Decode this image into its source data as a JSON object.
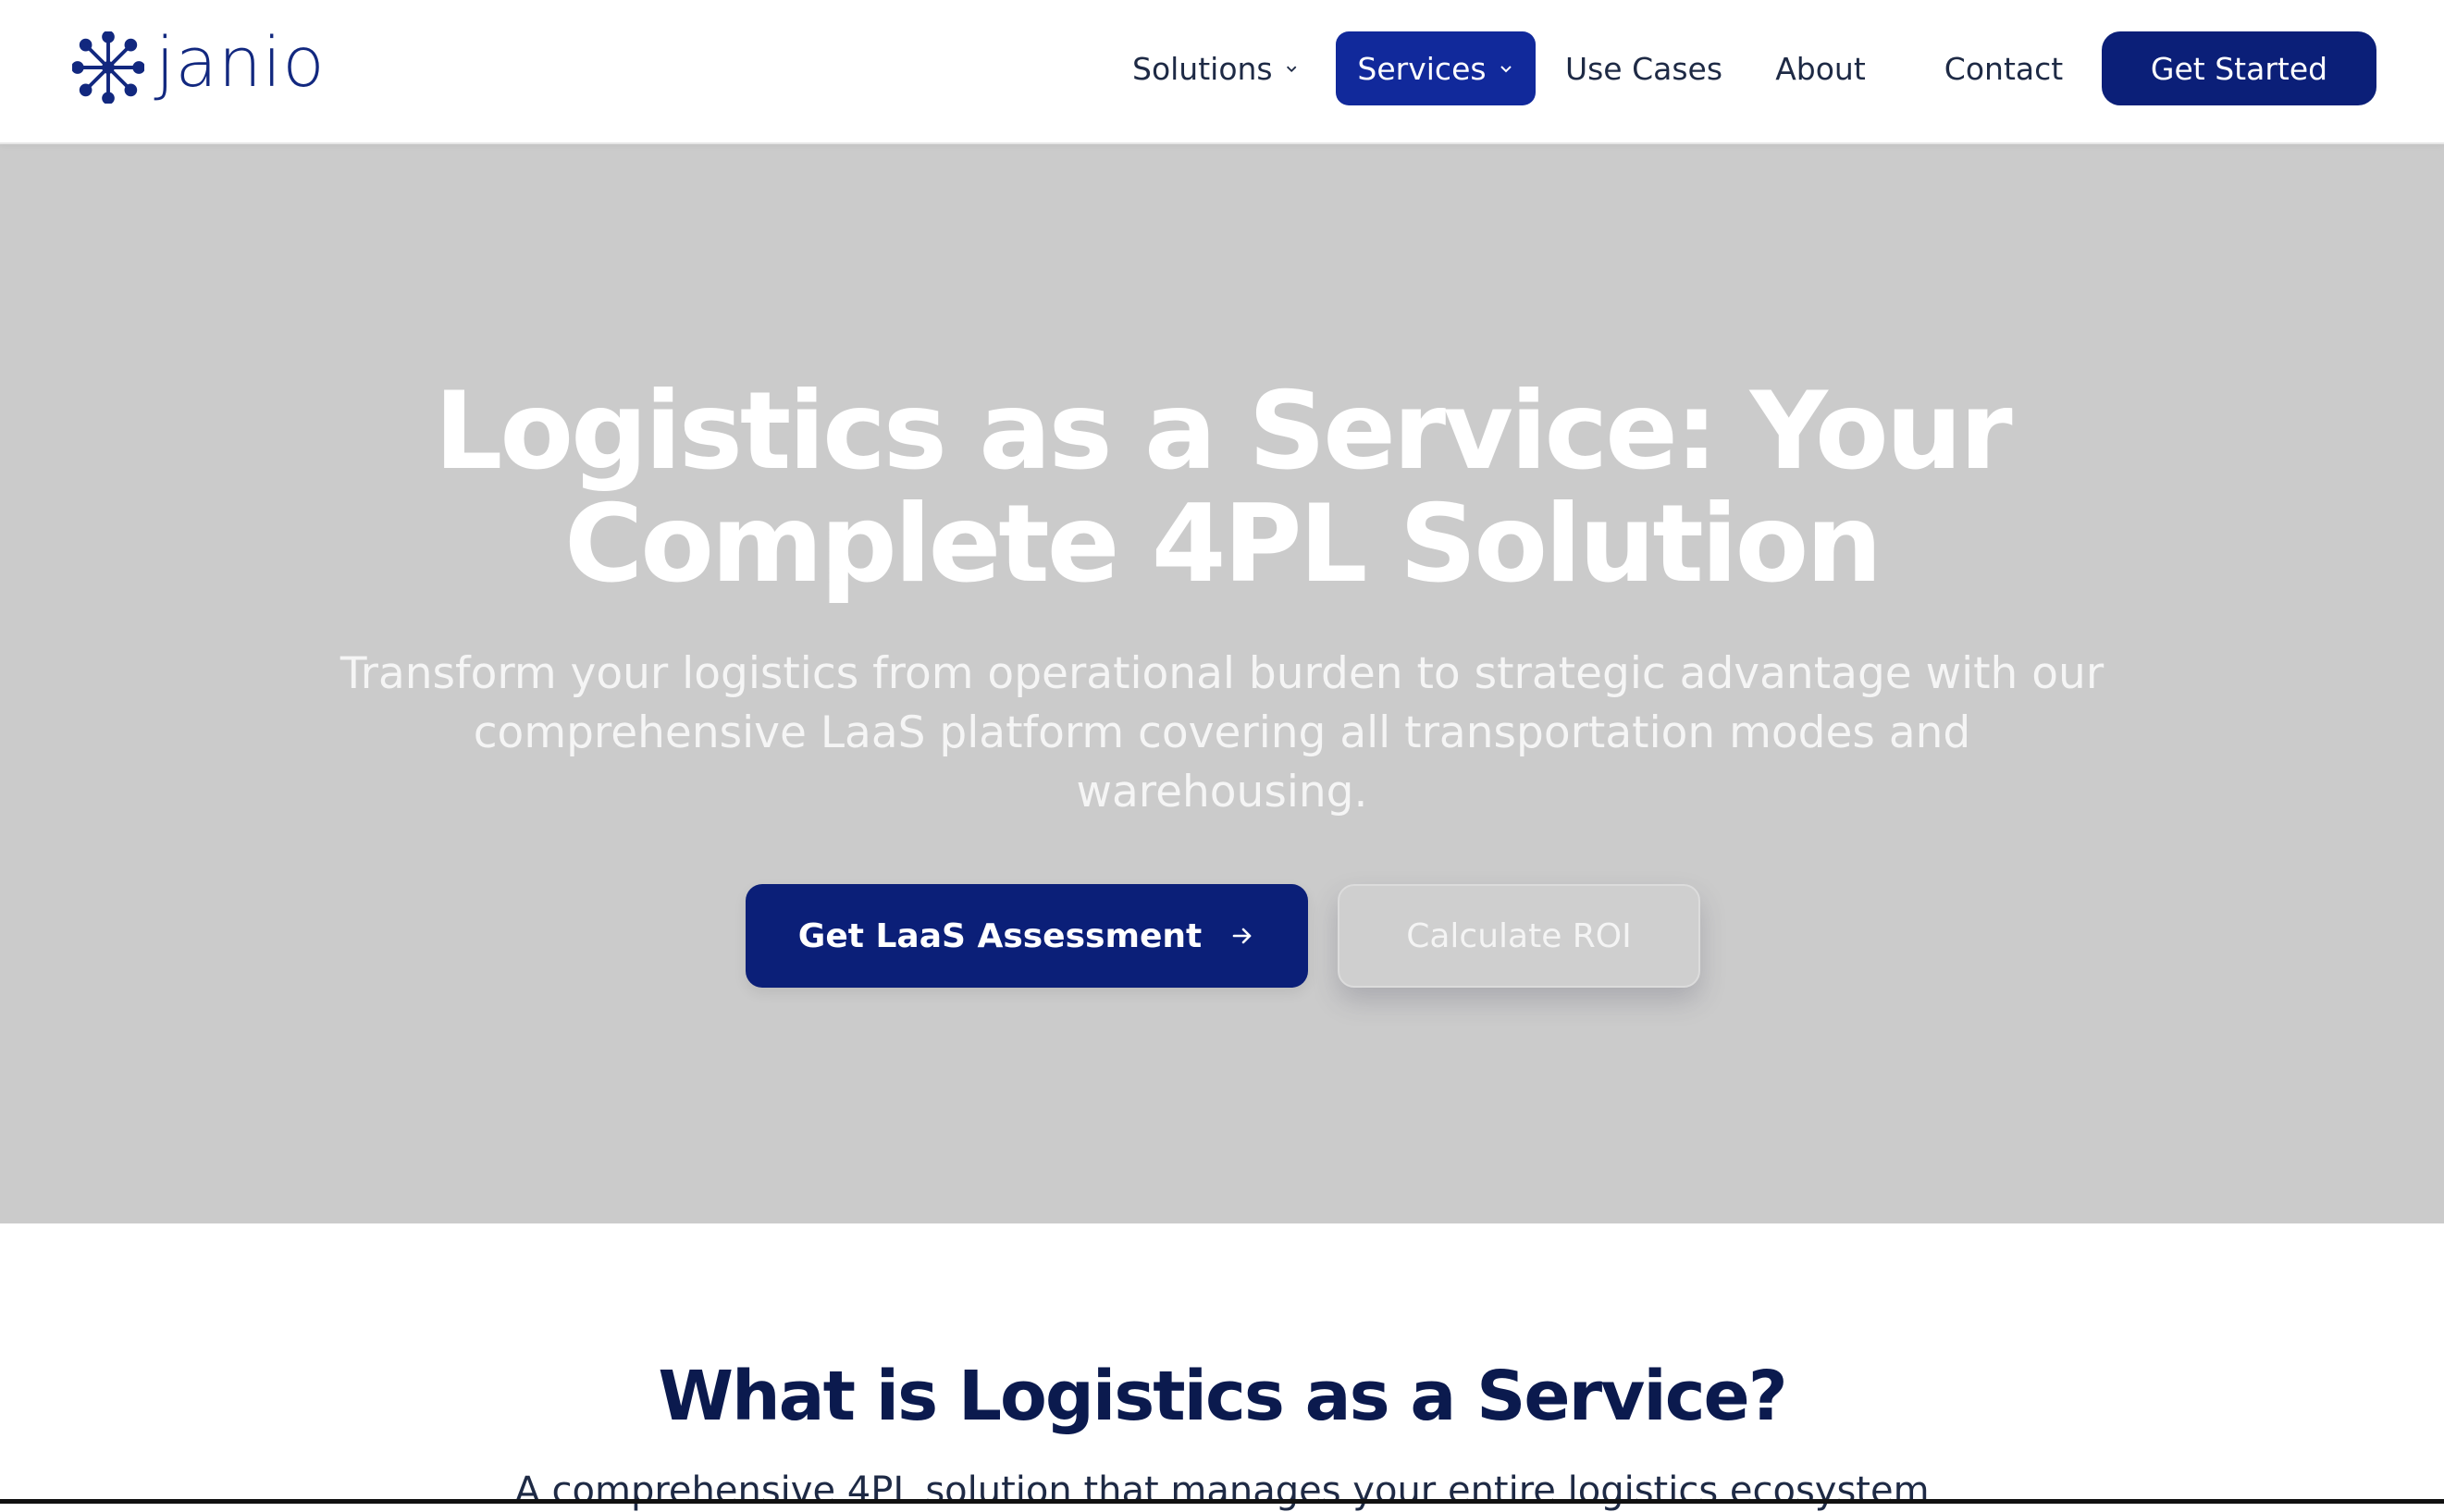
{
  "brand": {
    "name": "janio",
    "color": "#12287f"
  },
  "nav": {
    "items": [
      {
        "label": "Solutions"
      },
      {
        "label": "Services"
      },
      {
        "label": "Use Cases"
      },
      {
        "label": "About"
      },
      {
        "label": "Contact"
      }
    ],
    "active": "Services",
    "cta_label": "Get Started"
  },
  "hero": {
    "title_lines": [
      "Logistics as a Service: Your",
      "Complete 4PL Solution"
    ],
    "subtitle_lines": [
      "Transform your logistics from operational burden to strategic advantage with our",
      "comprehensive LaaS platform covering all transportation modes and",
      "warehousing."
    ],
    "primary_button": "Get LaaS Assessment",
    "secondary_button": "Calculate ROI"
  },
  "section": {
    "title": "What is Logistics as a Service?",
    "subtitle": "A comprehensive 4PL solution that manages your entire logistics ecosystem"
  },
  "colors": {
    "primary": "#0b1f78",
    "active_nav": "#11299b",
    "hero_bg": "#cbcbcb",
    "heading": "#0b1a4e"
  }
}
